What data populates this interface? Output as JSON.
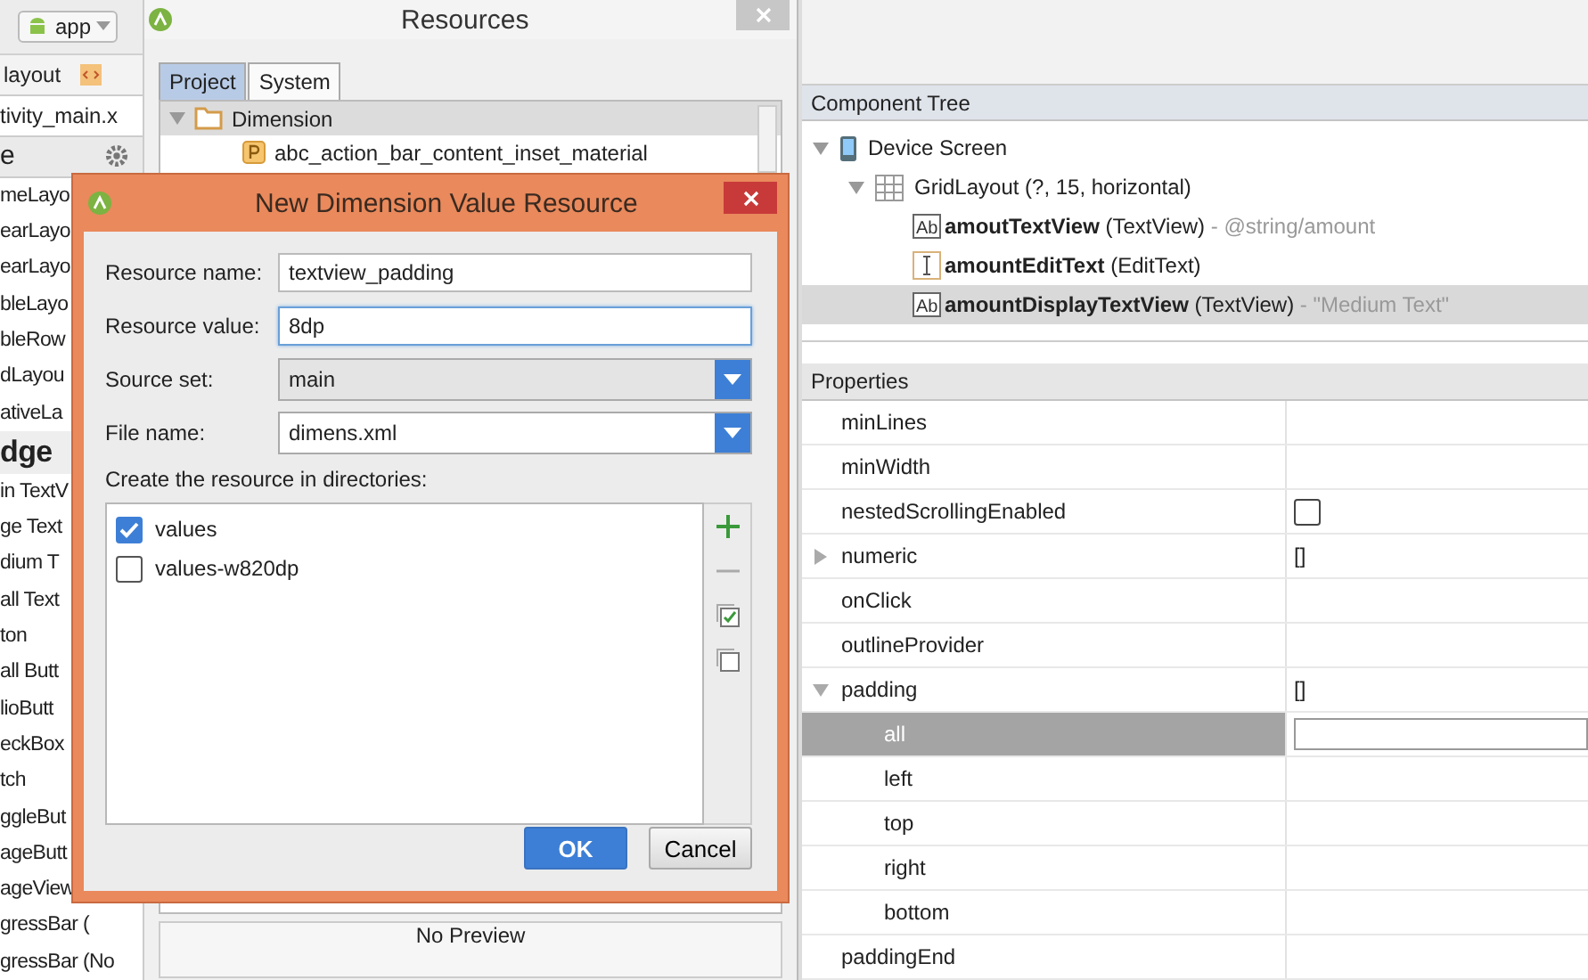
{
  "palette": {
    "module": "app",
    "breadcrumb": "layout",
    "file_tab": "tivity_main.x",
    "header": "e",
    "items": [
      {
        "kind": "item",
        "label": "meLayo"
      },
      {
        "kind": "item",
        "label": "earLayo"
      },
      {
        "kind": "item",
        "label": "earLayo"
      },
      {
        "kind": "item",
        "label": "bleLayo"
      },
      {
        "kind": "item",
        "label": "bleRow"
      },
      {
        "kind": "item",
        "label": "dLayou"
      },
      {
        "kind": "item",
        "label": "ativeLa"
      },
      {
        "kind": "section",
        "label": "dge"
      },
      {
        "kind": "item",
        "label": "in TextV"
      },
      {
        "kind": "item",
        "label": "ge Text"
      },
      {
        "kind": "item",
        "label": "dium T"
      },
      {
        "kind": "item",
        "label": "all Text"
      },
      {
        "kind": "item",
        "label": "ton"
      },
      {
        "kind": "item",
        "label": "all Butt"
      },
      {
        "kind": "item",
        "label": "lioButt"
      },
      {
        "kind": "item",
        "label": "eckBox"
      },
      {
        "kind": "item",
        "label": "tch"
      },
      {
        "kind": "item",
        "label": "ggleBut"
      },
      {
        "kind": "item",
        "label": "ageButt"
      },
      {
        "kind": "item",
        "label": "ageView"
      },
      {
        "kind": "item",
        "label": "gressBar ("
      },
      {
        "kind": "item",
        "label": "gressBar (No"
      }
    ]
  },
  "resources": {
    "title": "Resources",
    "tabs": [
      {
        "label": "Project",
        "selected": true
      },
      {
        "label": "System",
        "selected": false
      }
    ],
    "tree": [
      {
        "label": "Dimension",
        "expanded": true,
        "children": [
          {
            "label": "abc_action_bar_content_inset_material"
          }
        ]
      }
    ],
    "preview": "No Preview"
  },
  "dialog": {
    "title": "New Dimension Value Resource",
    "fields": [
      {
        "kind": "text",
        "label": "Resource name:",
        "value": "textview_padding",
        "focused": false
      },
      {
        "kind": "text",
        "label": "Resource value:",
        "value": "8dp",
        "focused": true
      },
      {
        "kind": "combo",
        "label": "Source set:",
        "value": "main",
        "editable": false
      },
      {
        "kind": "combo",
        "label": "File name:",
        "value": "dimens.xml",
        "editable": true
      }
    ],
    "directories_label": "Create the resource in directories:",
    "directories": [
      {
        "label": "values",
        "checked": true
      },
      {
        "label": "values-w820dp",
        "checked": false
      }
    ],
    "buttons": [
      {
        "kind": "primary",
        "label": "OK"
      },
      {
        "kind": "secondary",
        "label": "Cancel"
      }
    ]
  },
  "component_tree": {
    "title": "Component Tree",
    "nodes": [
      {
        "kind": "device",
        "label": "Device Screen",
        "expanded": true,
        "children": [
          {
            "kind": "grid",
            "label": "GridLayout (?, 15, horizontal)",
            "expanded": true,
            "children": [
              {
                "kind": "text",
                "icon_text": "Ab",
                "name": "amoutTextView",
                "type": "(TextView)",
                "detail": "- @string/amount",
                "selected": false
              },
              {
                "kind": "edit",
                "name": "amountEditText",
                "type": "(EditText)",
                "selected": false
              },
              {
                "kind": "text",
                "icon_text": "Ab",
                "name": "amountDisplayTextView",
                "type": "(TextView)",
                "detail": "- \"Medium Text\"",
                "selected": true
              }
            ]
          }
        ]
      }
    ]
  },
  "properties": {
    "title": "Properties",
    "rows": [
      {
        "kind": "plain",
        "name": "minLines"
      },
      {
        "kind": "plain",
        "name": "minWidth"
      },
      {
        "kind": "checkbox",
        "name": "nestedScrollingEnabled",
        "checked": false
      },
      {
        "kind": "group",
        "name": "numeric",
        "value": "[]",
        "expanded": false
      },
      {
        "kind": "plain",
        "name": "onClick"
      },
      {
        "kind": "plain",
        "name": "outlineProvider"
      },
      {
        "kind": "group",
        "name": "padding",
        "value": "[]",
        "expanded": true,
        "children": [
          {
            "kind": "field",
            "name": "all",
            "selected": true
          },
          {
            "kind": "plain",
            "name": "left",
            "selected": false
          },
          {
            "kind": "plain",
            "name": "top",
            "selected": false
          },
          {
            "kind": "plain",
            "name": "right",
            "selected": false
          },
          {
            "kind": "plain",
            "name": "bottom",
            "selected": false
          }
        ]
      },
      {
        "kind": "plain",
        "name": "paddingEnd"
      }
    ]
  }
}
